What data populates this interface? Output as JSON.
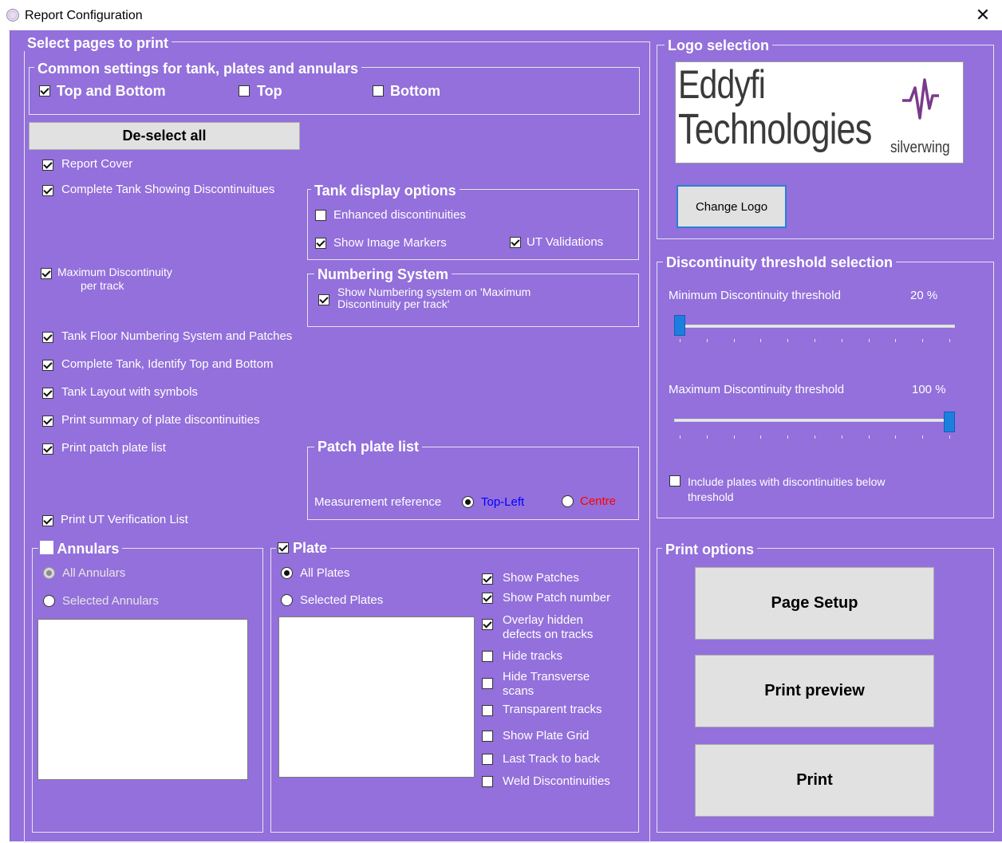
{
  "window": {
    "title": "Report Configuration",
    "close_glyph": "✕"
  },
  "pages": {
    "legend": "Select pages to print",
    "common": {
      "legend": "Common settings for tank, plates and annulars",
      "top_and_bottom": {
        "label": "Top and Bottom",
        "checked": true
      },
      "top": {
        "label": "Top",
        "checked": false
      },
      "bottom": {
        "label": "Bottom",
        "checked": false
      }
    },
    "deselect_all": "De-select all",
    "items": {
      "report_cover": {
        "label": "Report Cover",
        "checked": true
      },
      "complete_tank": {
        "label": "Complete Tank Showing Discontinuitues",
        "checked": true
      },
      "max_disc_line1": "Maximum Discontinuity",
      "max_disc_line2": "per track",
      "floor_numbering": {
        "label": "Tank Floor Numbering System and Patches",
        "checked": true
      },
      "identify_top_bottom": {
        "label": "Complete Tank, Identify Top and Bottom",
        "checked": true
      },
      "tank_layout": {
        "label": "Tank Layout with symbols",
        "checked": true
      },
      "plate_summary": {
        "label": "Print summary of plate discontinuities",
        "checked": true
      },
      "patch_list": {
        "label": "Print patch plate list",
        "checked": true
      },
      "ut_verification": {
        "label": "Print UT Verification List",
        "checked": true
      }
    },
    "tank_display": {
      "legend": "Tank display options",
      "enhanced": {
        "label": "Enhanced discontinuities",
        "checked": false
      },
      "image_markers": {
        "label": "Show Image Markers",
        "checked": true
      },
      "ut_validations": {
        "label": "UT Validations",
        "checked": true
      }
    },
    "numbering": {
      "legend": "Numbering System",
      "line1": "Show Numbering system on 'Maximum",
      "line2": "Discontinuity per track'"
    },
    "patch_plate": {
      "legend": "Patch plate list",
      "measurement_label": "Measurement reference",
      "top_left": "Top-Left",
      "centre": "Centre",
      "top_left_color": "#0000ff",
      "centre_color": "#ff0000"
    },
    "annulars": {
      "legend": "Annulars",
      "all": "All Annulars",
      "selected": "Selected Annulars"
    },
    "plate": {
      "legend": "Plate",
      "all": "All Plates",
      "selected": "Selected Plates",
      "options": {
        "show_patches": "Show Patches",
        "show_patch_number": "Show  Patch number",
        "overlay_line1": "Overlay hidden",
        "overlay_line2": "defects on tracks",
        "hide_tracks": "Hide tracks",
        "hide_transverse_line1": "Hide Transverse",
        "hide_transverse_line2": "scans",
        "transparent_tracks": "Transparent tracks",
        "show_plate_grid": "Show Plate Grid",
        "last_track_back": "Last Track to back",
        "weld_discontinuities": "Weld Discontinuities"
      }
    }
  },
  "logo": {
    "legend": "Logo selection",
    "brand_line1": "Eddyfi",
    "brand_line2": "Technologies",
    "brand_sub": "silverwing",
    "change_button": "Change Logo",
    "logo_color": "#3a3a3a",
    "mark_color": "#7a3a8a"
  },
  "threshold": {
    "legend": "Discontinuity threshold selection",
    "min_label": "Minimum Discontinuity threshold",
    "min_value": "20 %",
    "min_fraction": 0.0,
    "max_label": "Maximum Discontinuity threshold",
    "max_value": "100 %",
    "max_fraction": 1.0,
    "include_line1": "Include plates with discontinuities below",
    "include_line2": "threshold"
  },
  "print": {
    "legend": "Print options",
    "page_setup": "Page Setup",
    "preview": "Print preview",
    "print": "Print"
  },
  "colors": {
    "background": "#9370db",
    "thumb": "#1c7fe0"
  }
}
